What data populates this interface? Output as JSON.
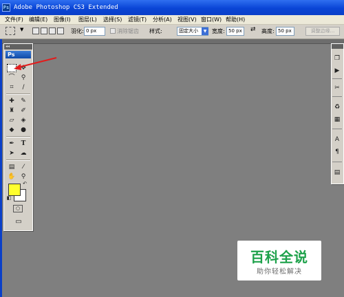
{
  "window": {
    "title": "Adobe Photoshop CS3 Extended",
    "app_icon": "Ps"
  },
  "menu": [
    "文件(F)",
    "编辑(E)",
    "图像(I)",
    "图层(L)",
    "选择(S)",
    "滤镜(T)",
    "分析(A)",
    "视图(V)",
    "窗口(W)",
    "帮助(H)"
  ],
  "options": {
    "feather_label": "羽化:",
    "feather_value": "0 px",
    "antialias_label": "消除锯齿",
    "style_label": "样式:",
    "style_value": "固定大小",
    "width_label": "宽度:",
    "width_value": "50 px",
    "height_label": "高度:",
    "height_value": "50 px",
    "refine_edge_label": "调整边缘..."
  },
  "toolbox": {
    "header_label": "Ps",
    "foreground_color": "#ffff2e",
    "background_color": "#ffffff"
  },
  "watermark": {
    "title": "百科全说",
    "subtitle": "助你轻松解决"
  },
  "colors": {
    "title_bar": "#0a45d6",
    "workspace": "#7f7f7f",
    "annotation_arrow": "#e21b1b",
    "watermark_green": "#1da14a"
  }
}
